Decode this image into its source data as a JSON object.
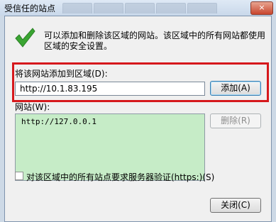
{
  "window": {
    "title": "受信任的站点",
    "close_label": "×"
  },
  "intro_text": "可以添加和删除该区域的网站。该区域中的所有网站都使用区域的安全设置。",
  "add_section": {
    "label": "将该网站添加到区域(D):",
    "url_value": "http://10.1.83.195",
    "add_button": "添加(A)"
  },
  "sites_section": {
    "label": "网站(W):",
    "items": [
      "http://127.0.0.1"
    ],
    "remove_button": "删除(R)"
  },
  "https_checkbox": {
    "checked": false,
    "label": "对该区域中的所有站点要求服务器验证(https:)(S)"
  },
  "close_button": "关闭(C)",
  "colors": {
    "highlight_border": "#d6181c",
    "list_background": "#c6ecc7",
    "check_green": "#3aa532"
  },
  "icons": {
    "header": "green-check-icon"
  }
}
